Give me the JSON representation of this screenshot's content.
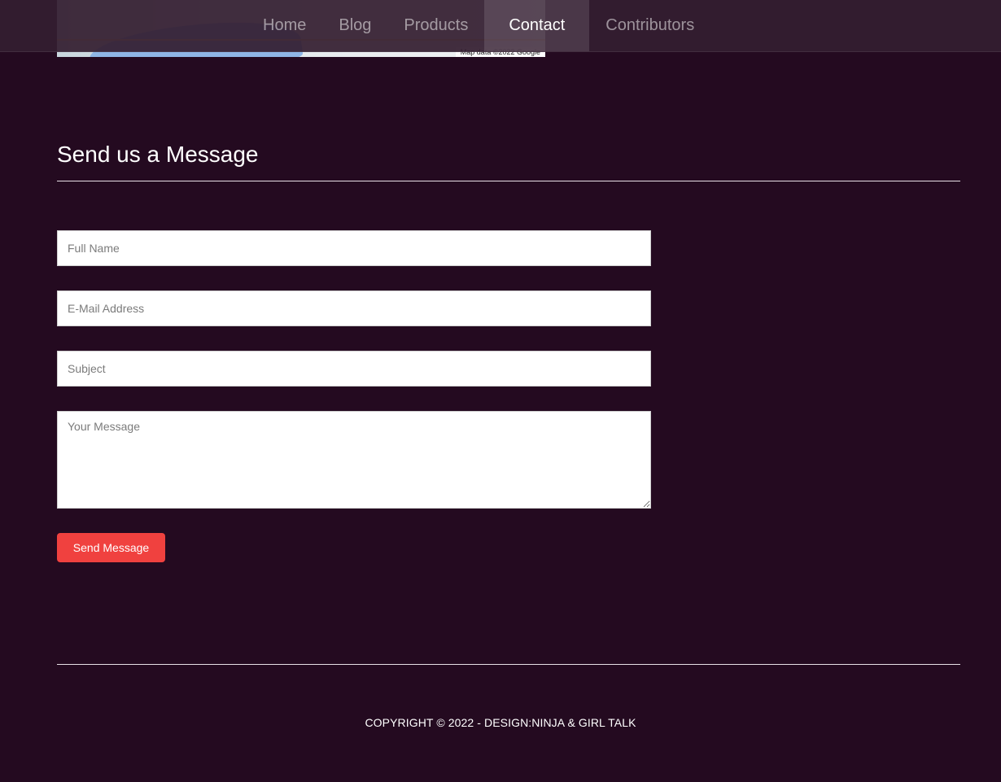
{
  "nav": {
    "items": [
      {
        "label": "Home",
        "active": false
      },
      {
        "label": "Blog",
        "active": false
      },
      {
        "label": "Products",
        "active": false
      },
      {
        "label": "Contact",
        "active": true
      },
      {
        "label": "Contributors",
        "active": false
      }
    ]
  },
  "map": {
    "attribution": "Map data ©2022 Google"
  },
  "contact": {
    "title": "Send us a Message",
    "form": {
      "full_name_placeholder": "Full Name",
      "email_placeholder": "E-Mail Address",
      "subject_placeholder": "Subject",
      "message_placeholder": "Your Message",
      "submit_label": "Send Message"
    }
  },
  "footer": {
    "copyright": "COPYRIGHT © 2022 - DESIGN:NINJA & GIRL TALK"
  },
  "colors": {
    "background": "#240a20",
    "accent": "#f0413f",
    "nav_background": "#341e30"
  }
}
